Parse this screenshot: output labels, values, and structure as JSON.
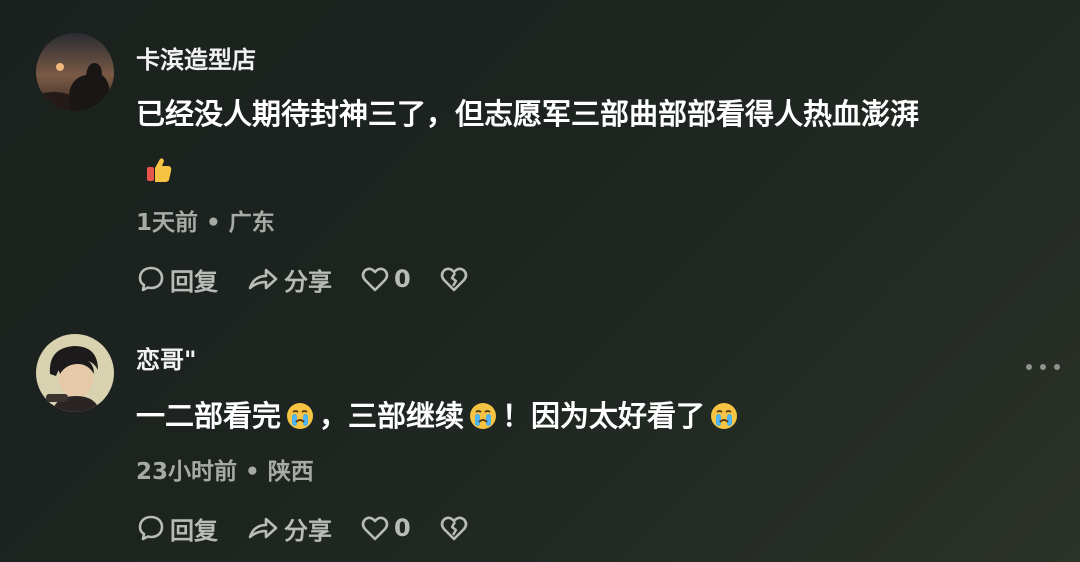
{
  "comments": [
    {
      "username": "卡滨造型店",
      "text": "已经没人期待封神三了，但志愿军三部曲部部看得人热血澎湃",
      "emoji_line": "thumbs-up-icon",
      "time": "1天前",
      "location": "广东",
      "reply_label": "回复",
      "share_label": "分享",
      "like_count": "0"
    },
    {
      "username": "恋哥\"",
      "text_part1": "一二部看完",
      "text_part2": "，三部继续",
      "text_part3": "！因为太好看了",
      "emoji": "crying-face-icon",
      "time": "23小时前",
      "location": "陕西",
      "reply_label": "回复",
      "share_label": "分享",
      "like_count": "0"
    }
  ],
  "colors": {
    "background": "#1d231f",
    "meta_text": "#a7aba6",
    "action_text": "#b8bcb6"
  }
}
